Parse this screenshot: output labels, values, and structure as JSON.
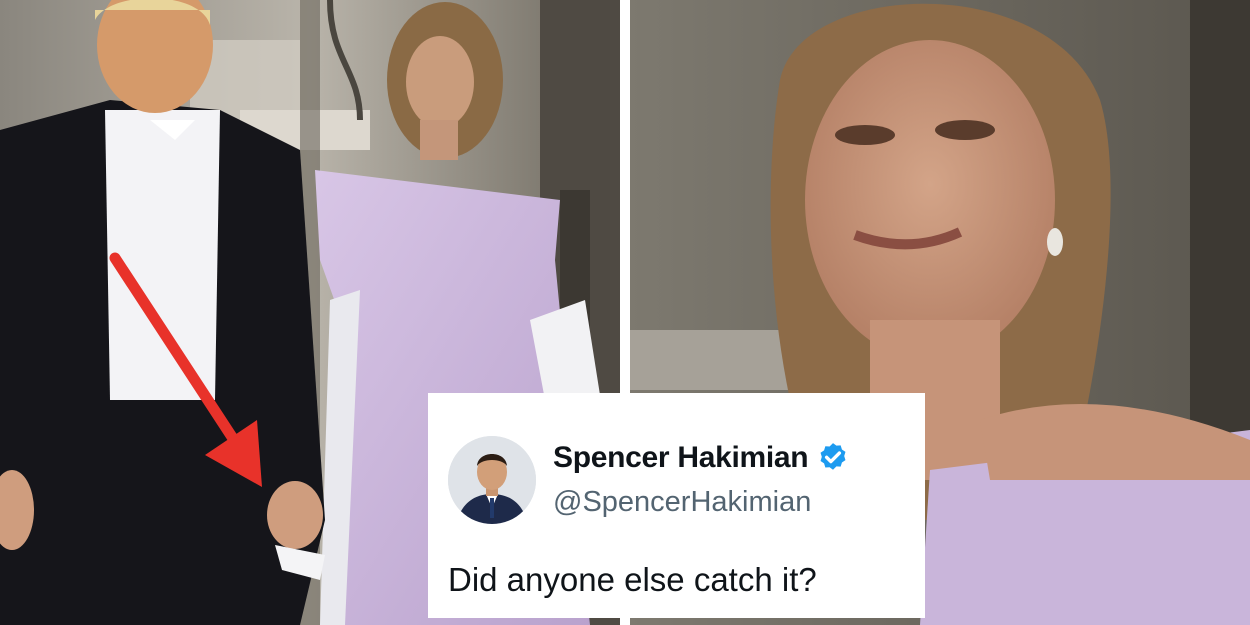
{
  "tweet": {
    "display_name": "Spencer Hakimian",
    "handle": "@SpencerHakimian",
    "text": "Did anyone else catch it?",
    "verified": true,
    "badge_color": "#1d9bf0"
  },
  "colors": {
    "arrow": "#e8322a",
    "dress": "#c9b5da",
    "tuxedo": "#15151a"
  },
  "icons": [
    "verified-badge-icon",
    "red-arrow-icon",
    "avatar"
  ]
}
